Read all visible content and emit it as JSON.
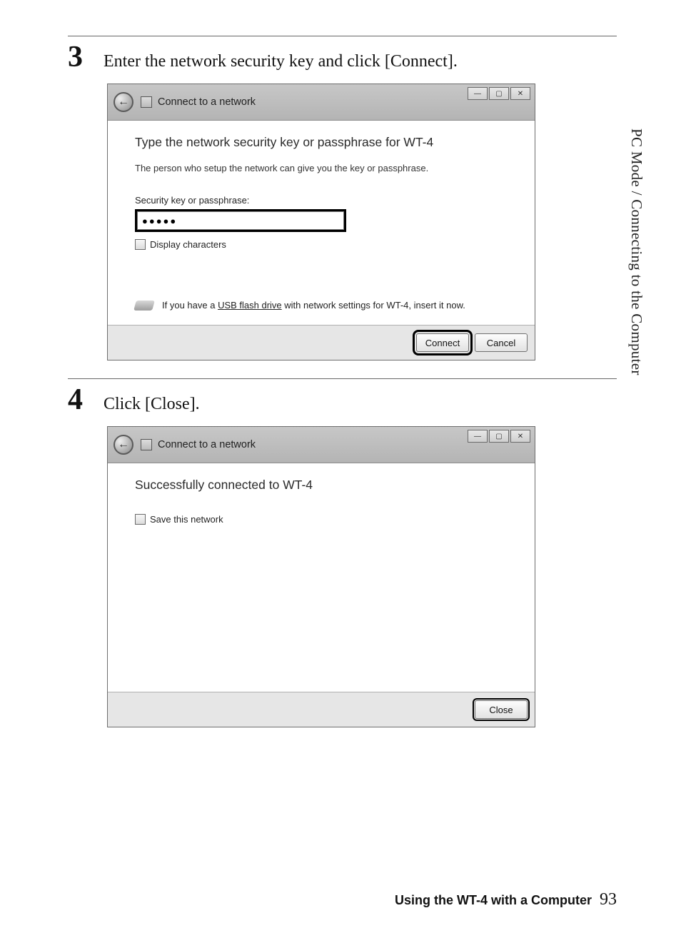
{
  "sideTab": "PC Mode / Connecting to the Computer",
  "step3": {
    "num": "3",
    "text": "Enter the network security key and click [Connect].",
    "dialog": {
      "title": "Connect to a network",
      "heading": "Type the network security key or passphrase for WT-4",
      "sub": "The person who setup the network can give you the key or passphrase.",
      "fieldLabel": "Security key or passphrase:",
      "passValue": "●●●●●",
      "displayChars": "Display characters",
      "usbBefore": "If you have a ",
      "usbLink": "USB flash drive",
      "usbAfter": " with network settings for WT-4, insert it now.",
      "connect": "Connect",
      "cancel": "Cancel"
    }
  },
  "step4": {
    "num": "4",
    "text": "Click [Close].",
    "dialog": {
      "title": "Connect to a network",
      "heading": "Successfully connected to WT-4",
      "saveNetwork": "Save this network",
      "close": "Close"
    }
  },
  "footer": {
    "text": "Using the WT-4 with a Computer",
    "page": "93"
  },
  "winCtrls": {
    "min": "—",
    "max": "▢",
    "close": "✕"
  }
}
